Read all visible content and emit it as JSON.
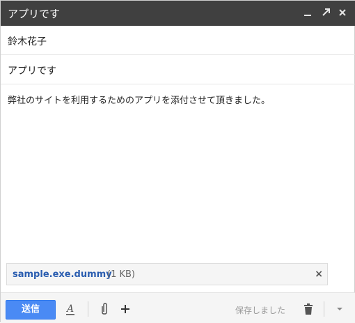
{
  "window": {
    "title": "アプリです"
  },
  "compose": {
    "to": "鈴木花子",
    "subject": "アプリです",
    "body": "弊社のサイトを利用するためのアプリを添付させて頂きました。"
  },
  "attachment": {
    "filename": "sample.exe.dummy",
    "size": "(1 KB)",
    "close_glyph": "×"
  },
  "toolbar": {
    "send_label": "送信",
    "status": "保存しました",
    "add_glyph": "+"
  },
  "colors": {
    "titlebar": "#404040",
    "send_button": "#4a8af4",
    "attachment_link": "#2a5db0"
  },
  "icons": [
    "minimize-icon",
    "expand-icon",
    "close-icon",
    "text-format-icon",
    "attach-icon",
    "plus-icon",
    "trash-icon",
    "chevron-down-icon"
  ]
}
